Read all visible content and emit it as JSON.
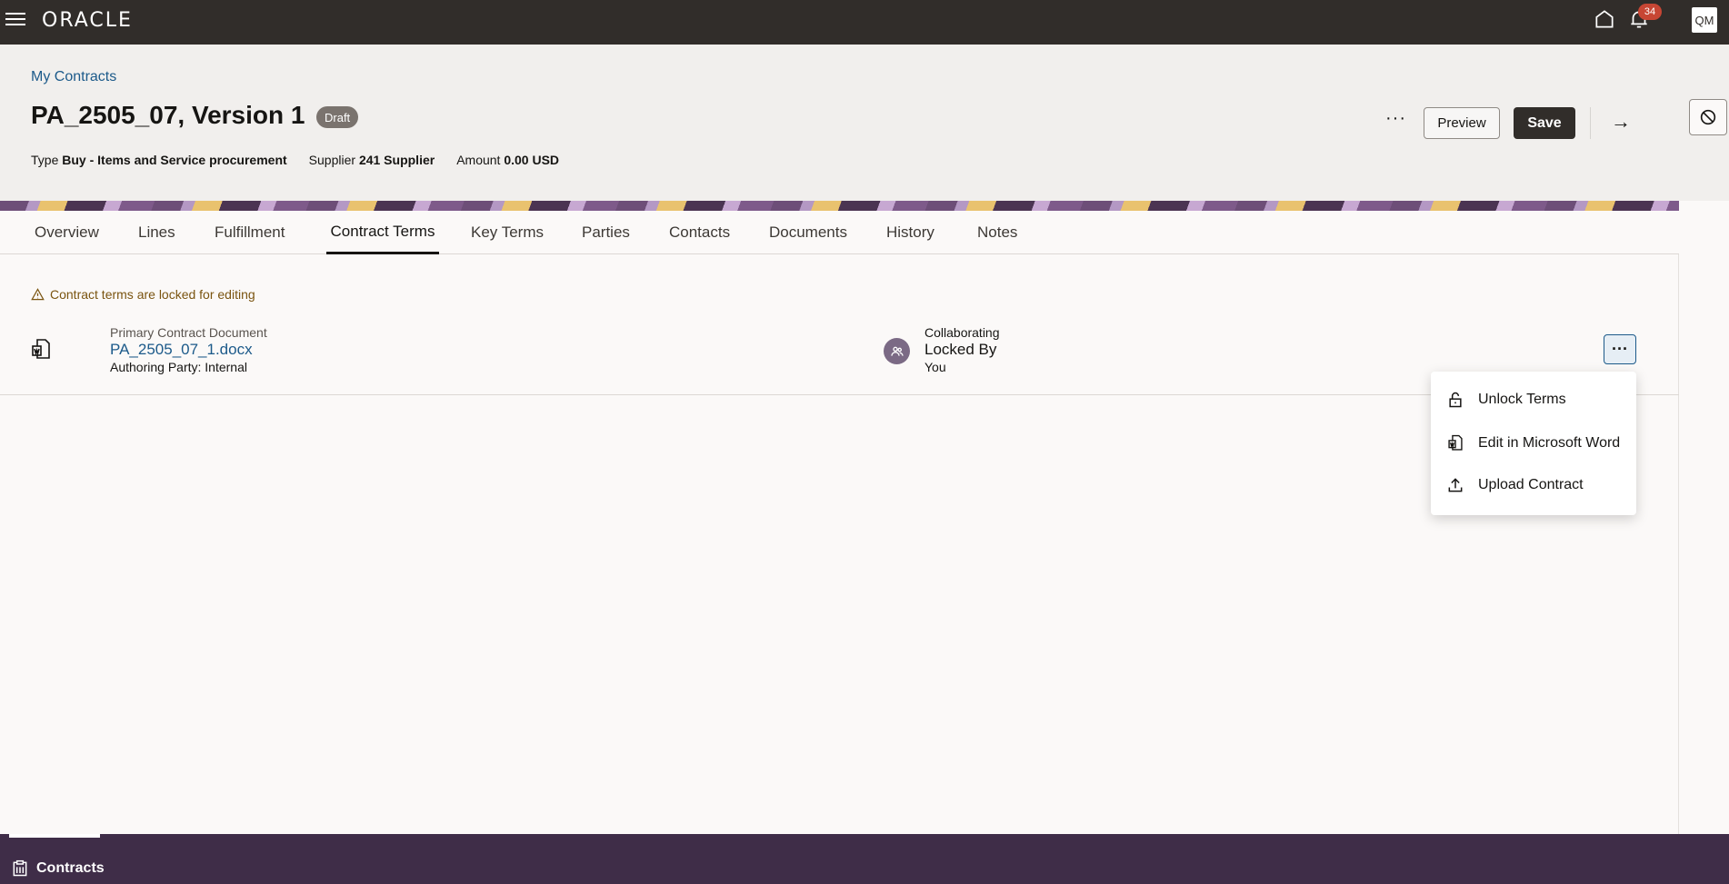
{
  "topbar": {
    "logo": "ORACLE",
    "notification_count": "34",
    "user_initials": "QM"
  },
  "header": {
    "breadcrumb": "My Contracts",
    "title": "PA_2505_07, Version 1",
    "status": "Draft",
    "meta": {
      "type_label": "Type",
      "type_value": "Buy - Items and Service procurement",
      "supplier_label": "Supplier",
      "supplier_value": "241 Supplier",
      "amount_label": "Amount",
      "amount_value": "0.00 USD"
    },
    "actions": {
      "more": "···",
      "preview": "Preview",
      "save": "Save",
      "next": "→"
    }
  },
  "tabs": [
    {
      "label": "Overview"
    },
    {
      "label": "Lines"
    },
    {
      "label": "Fulfillment"
    },
    {
      "label": "Contract Terms",
      "active": true
    },
    {
      "label": "Key Terms"
    },
    {
      "label": "Parties"
    },
    {
      "label": "Contacts"
    },
    {
      "label": "Documents"
    },
    {
      "label": "History"
    },
    {
      "label": "Notes"
    }
  ],
  "content": {
    "warning": "Contract terms are locked for editing",
    "document": {
      "label": "Primary Contract Document",
      "file": "PA_2505_07_1.docx",
      "party": "Authoring Party: Internal"
    },
    "collaboration": {
      "title": "Collaborating",
      "locked_by": "Locked By",
      "locked_by_user": "You"
    },
    "row_menu": "···"
  },
  "menu": {
    "items": [
      {
        "label": "Unlock Terms",
        "icon": "unlock-icon"
      },
      {
        "label": "Edit in Microsoft Word",
        "icon": "word-doc-icon"
      },
      {
        "label": "Upload Contract",
        "icon": "upload-icon"
      }
    ]
  },
  "dock": {
    "label": "Contracts"
  },
  "colors": {
    "topbar": "#312d2a",
    "link": "#1c5a8a",
    "dock": "#3f2d48",
    "badge": "#c74634"
  }
}
